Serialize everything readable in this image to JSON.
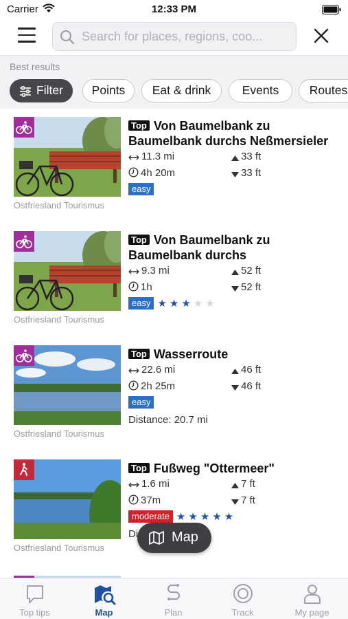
{
  "status_bar": {
    "carrier": "Carrier",
    "time": "12:33 PM"
  },
  "search": {
    "placeholder": "Search for places, regions, coo..."
  },
  "results": {
    "heading": "Best results",
    "chips": [
      {
        "label": "Filter",
        "active": true
      },
      {
        "label": "Points"
      },
      {
        "label": "Eat & drink"
      },
      {
        "label": "Events"
      },
      {
        "label": "Routes"
      }
    ]
  },
  "tours": [
    {
      "category": "bike",
      "tag": "Top",
      "title": "Von Baumelbank zu Baumelbank durchs Neßmersieler",
      "distance": "11.3 mi",
      "duration": "4h 20m",
      "ascent": "33 ft",
      "descent": "33 ft",
      "difficulty": "easy",
      "stars": null,
      "extra": "",
      "credit": "Ostfriesland Tourismus"
    },
    {
      "category": "bike",
      "tag": "Top",
      "title": "Von Baumelbank zu Baumelbank durchs",
      "distance": "9.3 mi",
      "duration": "1h",
      "ascent": "52 ft",
      "descent": "52 ft",
      "difficulty": "easy",
      "stars": 3,
      "extra": "",
      "credit": "Ostfriesland Tourismus"
    },
    {
      "category": "bike",
      "tag": "Top",
      "title": "Wasserroute",
      "distance": "22.6 mi",
      "duration": "2h 25m",
      "ascent": "46 ft",
      "descent": "46 ft",
      "difficulty": "easy",
      "stars": null,
      "extra": "Distance: 20.7 mi",
      "credit": "Ostfriesland Tourismus"
    },
    {
      "category": "hike",
      "tag": "Top",
      "title": "Fußweg \"Ottermeer\"",
      "distance": "1.6 mi",
      "duration": "37m",
      "ascent": "7 ft",
      "descent": "7 ft",
      "difficulty": "moderate",
      "stars": 5,
      "extra": "Di",
      "credit": "Ostfriesland Tourismus"
    }
  ],
  "map_button": {
    "label": "Map"
  },
  "tabs": [
    {
      "label": "Top tips",
      "icon": "chat-bubble-icon"
    },
    {
      "label": "Map",
      "icon": "map-search-icon",
      "active": true
    },
    {
      "label": "Plan",
      "icon": "route-plan-icon"
    },
    {
      "label": "Track",
      "icon": "track-record-icon"
    },
    {
      "label": "My page",
      "icon": "person-icon"
    }
  ],
  "colors": {
    "bike_badge": "#a12e9b",
    "hike_badge": "#c4293a",
    "easy": "#2a6fca",
    "moderate": "#d3232a",
    "accent": "#1f4f9f"
  }
}
